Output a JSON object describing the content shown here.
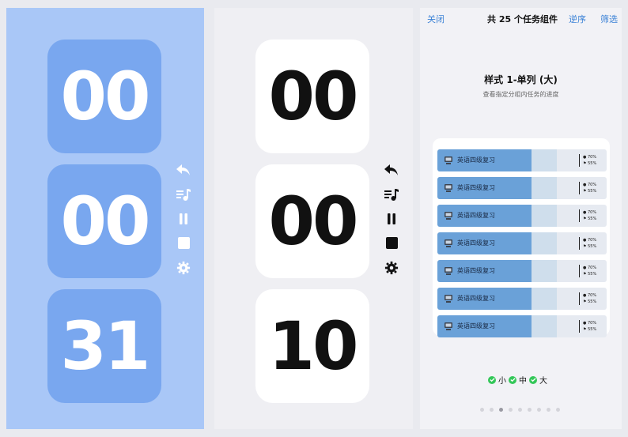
{
  "timer_blue": {
    "hours": "00",
    "minutes": "00",
    "seconds": "31"
  },
  "timer_white": {
    "hours": "00",
    "minutes": "00",
    "seconds": "10"
  },
  "controls": [
    "back-icon",
    "playlist-music-icon",
    "pause-icon",
    "stop-icon",
    "gear-icon"
  ],
  "widget_picker": {
    "close_label": "关闭",
    "title": "共 25 个任务组件",
    "reverse_label": "逆序",
    "filter_label": "筛选",
    "style_title": "样式 1-单列 (大)",
    "style_subtitle": "查看指定分组内任务的进度",
    "tasks": [
      {
        "name": "英语四级复习",
        "stat1": "70%",
        "stat2": "55%"
      },
      {
        "name": "英语四级复习",
        "stat1": "70%",
        "stat2": "55%"
      },
      {
        "name": "英语四级复习",
        "stat1": "70%",
        "stat2": "55%"
      },
      {
        "name": "英语四级复习",
        "stat1": "70%",
        "stat2": "55%"
      },
      {
        "name": "英语四级复习",
        "stat1": "70%",
        "stat2": "55%"
      },
      {
        "name": "英语四级复习",
        "stat1": "70%",
        "stat2": "55%"
      },
      {
        "name": "英语四级复习",
        "stat1": "70%",
        "stat2": "55%"
      }
    ],
    "sizes": [
      "小",
      "中",
      "大"
    ],
    "page_count": 9,
    "current_page": 3
  },
  "colors": {
    "blue_panel": "#a9c7f7",
    "blue_tile": "#79a7ef",
    "accent": "#3b82d6",
    "progress": "#6aa1d8",
    "check": "#34c759"
  }
}
